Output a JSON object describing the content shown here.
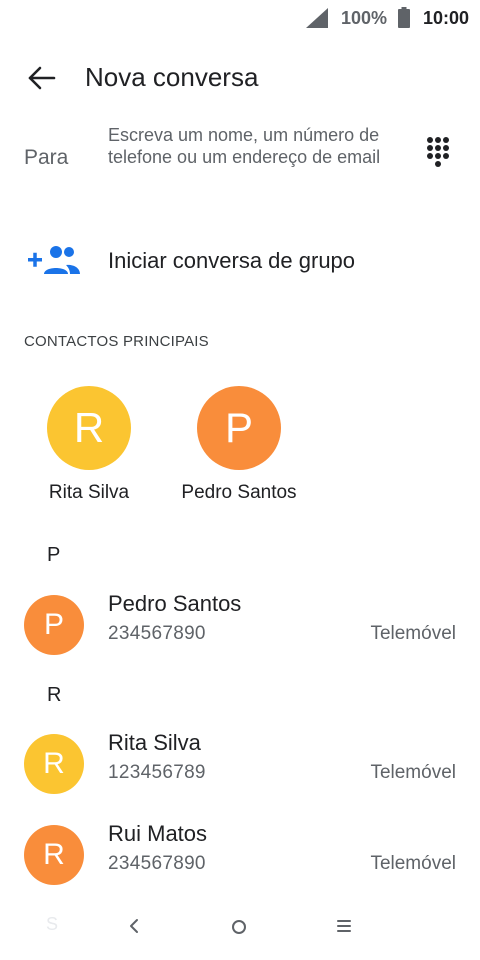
{
  "status_bar": {
    "battery_percent": "100%",
    "time": "10:00"
  },
  "app_bar": {
    "title": "Nova conversa",
    "back_icon": "arrow-back-icon"
  },
  "recipient": {
    "label": "Para",
    "placeholder": "Escreva um nome, um número de telefone ou um endereço de email",
    "dialpad_icon": "dialpad-icon"
  },
  "group_chat": {
    "label": "Iniciar conversa de grupo",
    "icon": "add-group-icon"
  },
  "top_contacts": {
    "header": "CONTACTOS PRINCIPAIS",
    "items": [
      {
        "initial": "R",
        "name": "Rita Silva",
        "color": "#fbc531"
      },
      {
        "initial": "P",
        "name": "Pedro Santos",
        "color": "#f98d3b"
      }
    ]
  },
  "contacts": {
    "groups": [
      {
        "letter": "P",
        "items": [
          {
            "initial": "P",
            "name": "Pedro Santos",
            "number": "234567890",
            "type": "Telemóvel",
            "color": "#f98d3b"
          }
        ]
      },
      {
        "letter": "R",
        "items": [
          {
            "initial": "R",
            "name": "Rita Silva",
            "number": "123456789",
            "type": "Telemóvel",
            "color": "#fbc531"
          },
          {
            "initial": "R",
            "name": "Rui Matos",
            "number": "234567890",
            "type": "Telemóvel",
            "color": "#f98d3b"
          }
        ]
      }
    ],
    "next_letter": "S"
  },
  "colors": {
    "accent_blue": "#1a73e8",
    "yellow_avatar": "#fbc531",
    "orange_avatar": "#f98d3b"
  }
}
